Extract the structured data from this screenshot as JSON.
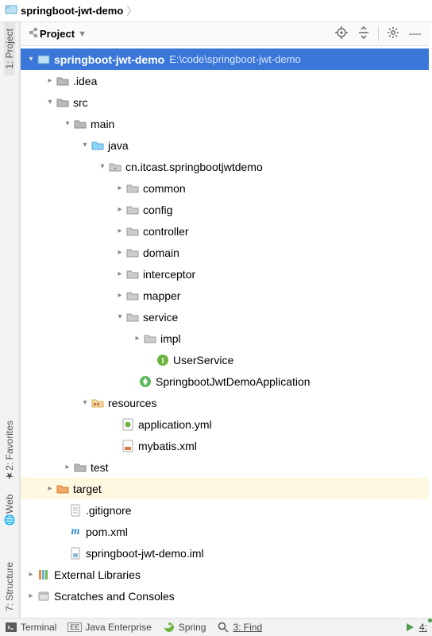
{
  "breadcrumb": {
    "project_name": "springboot-jwt-demo"
  },
  "panel": {
    "title": "Project"
  },
  "left_strip": {
    "project": "1: Project",
    "favorites": "2: Favorites",
    "web": "Web",
    "structure": "7: Structure"
  },
  "tree": {
    "root": {
      "name": "springboot-jwt-demo",
      "path": "E:\\code\\springboot-jwt-demo"
    },
    "idea": ".idea",
    "src": "src",
    "main": "main",
    "java": "java",
    "pkg": "cn.itcast.springbootjwtdemo",
    "common": "common",
    "config": "config",
    "controller": "controller",
    "domain": "domain",
    "interceptor": "interceptor",
    "mapper": "mapper",
    "service": "service",
    "impl": "impl",
    "user_service": "UserService",
    "app_class": "SpringbootJwtDemoApplication",
    "resources": "resources",
    "application_yml": "application.yml",
    "mybatis_xml": "mybatis.xml",
    "test": "test",
    "target": "target",
    "gitignore": ".gitignore",
    "pom": "pom.xml",
    "iml": "springboot-jwt-demo.iml",
    "external_libs": "External Libraries",
    "scratches": "Scratches and Consoles"
  },
  "bottom": {
    "terminal": "Terminal",
    "java_enterprise": "Java Enterprise",
    "spring": "Spring",
    "find": "3: Find",
    "run": "4:"
  }
}
